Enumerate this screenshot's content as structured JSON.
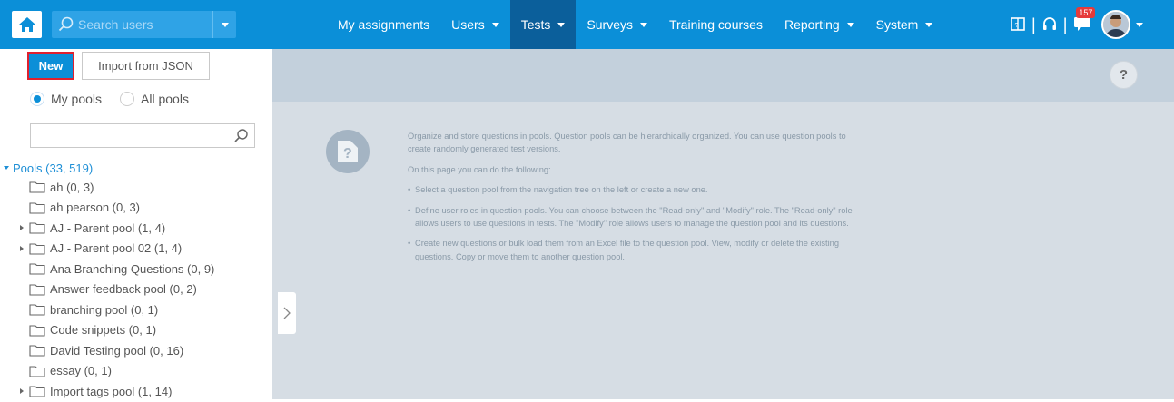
{
  "search": {
    "placeholder": "Search users"
  },
  "nav": [
    {
      "label": "My assignments",
      "dropdown": false,
      "active": false
    },
    {
      "label": "Users",
      "dropdown": true,
      "active": false
    },
    {
      "label": "Tests",
      "dropdown": true,
      "active": true
    },
    {
      "label": "Surveys",
      "dropdown": true,
      "active": false
    },
    {
      "label": "Training courses",
      "dropdown": false,
      "active": false
    },
    {
      "label": "Reporting",
      "dropdown": true,
      "active": false
    },
    {
      "label": "System",
      "dropdown": true,
      "active": false
    }
  ],
  "header_icons": [
    "book-icon",
    "headset-icon",
    "notification-icon"
  ],
  "notifications_count": "157",
  "left": {
    "new_button": "New",
    "import_button": "Import from JSON",
    "radio": {
      "my_pools": "My pools",
      "all_pools": "All pools",
      "selected": "my_pools"
    },
    "tree_search_value": ""
  },
  "tree": {
    "root": "Pools (33, 519)",
    "items": [
      {
        "label": "ah (0, 3)",
        "expandable": false
      },
      {
        "label": "ah pearson (0, 3)",
        "expandable": false
      },
      {
        "label": "AJ - Parent pool (1, 4)",
        "expandable": true
      },
      {
        "label": "AJ - Parent pool 02 (1, 4)",
        "expandable": true
      },
      {
        "label": "Ana Branching Questions (0, 9)",
        "expandable": false
      },
      {
        "label": "Answer feedback pool (0, 2)",
        "expandable": false
      },
      {
        "label": "branching pool (0, 1)",
        "expandable": false
      },
      {
        "label": "Code snippets (0, 1)",
        "expandable": false
      },
      {
        "label": "David Testing pool (0, 16)",
        "expandable": false
      },
      {
        "label": "essay (0, 1)",
        "expandable": false
      },
      {
        "label": "Import tags pool (1, 14)",
        "expandable": true
      }
    ]
  },
  "help_label": "?",
  "info": {
    "intro": "Organize and store questions in pools. Question pools can be hierarchically organized. You can use question pools to create randomly generated test versions.",
    "lead": "On this page you can do the following:",
    "bullets": [
      "Select a question pool from the navigation tree on the left or create a new one.",
      "Define user roles in question pools. You can choose between the \"Read-only\" and \"Modify\" role. The \"Read-only\" role allows users to use questions in tests. The \"Modify\" role allows users to manage the question pool and its questions.",
      "Create new questions or bulk load them from an Excel file to the question pool. View, modify or delete the existing questions. Copy or move them to another question pool."
    ]
  },
  "colors": {
    "topbar": "#0b8fd8",
    "active_nav": "#0b5f9b",
    "main_bg": "#d6dde4",
    "main_header": "#c3d0dc",
    "highlight": "#e0202e"
  }
}
